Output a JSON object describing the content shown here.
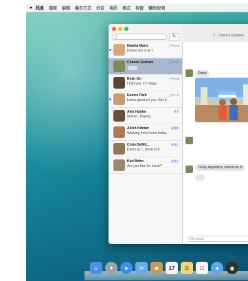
{
  "menubar": {
    "apple": "",
    "items": [
      "訊息",
      "檔案",
      "編輯",
      "顯示方式",
      "好友",
      "視訊",
      "格式",
      "視窗",
      "輔助說明"
    ]
  },
  "window": {
    "search_placeholder": "Q",
    "compose_icon": "compose-icon",
    "chat_title": "Chance Graham"
  },
  "conversations": [
    {
      "name": "Natalia Maric",
      "time": "上午8:41",
      "preview": "Dinner rez is at 7.",
      "unread": true,
      "avatar_color": "#d8a679"
    },
    {
      "name": "Chance Graham",
      "time": "上午8:40",
      "preview": "",
      "unread": false,
      "selected": true,
      "typing": true,
      "avatar_color": "#7a8c5c"
    },
    {
      "name": "Ryan Orr",
      "time": "上午8:08",
      "preview": "I told you, it's magic.",
      "unread": false,
      "avatar_color": "#5a4636"
    },
    {
      "name": "Eunice Park",
      "time": "上午7:23",
      "preview": "Looks great on you. Get it.",
      "unread": true,
      "avatar_color": "#c79a7a"
    },
    {
      "name": "Alex Hunter",
      "time": "昨天",
      "preview": "Will do. Thanks.",
      "unread": false,
      "avatar_color": "#6b5038"
    },
    {
      "name": "Ailish Kimber",
      "time": "星期四",
      "preview": "Working from home today.",
      "unread": false,
      "avatar_color": "#b07a55"
    },
    {
      "name": "Chris DeWit...",
      "time": "星期三",
      "preview": "Doors at 7, show at 8.",
      "unread": false,
      "avatar_color": "#8e7a5a"
    },
    {
      "name": "Karl Bohn",
      "time": "星期三",
      "preview": "Are you free for lunch?",
      "unread": false,
      "avatar_color": "#9a8a70"
    }
  ],
  "chat": {
    "messages": [
      "Done!",
      "Today Argentina, tomorrow th"
    ],
    "input_placeholder": "iMessage"
  },
  "dock": [
    "finder-icon",
    "launchpad-icon",
    "safari-icon",
    "mail-icon",
    "contacts-icon",
    "calendar-icon",
    "notes-icon",
    "reminders-icon",
    "messages-icon",
    "facetime-icon"
  ],
  "calendar_day": "17",
  "colors": {
    "accent": "#3478f6",
    "selected": "#a8b9cf"
  }
}
